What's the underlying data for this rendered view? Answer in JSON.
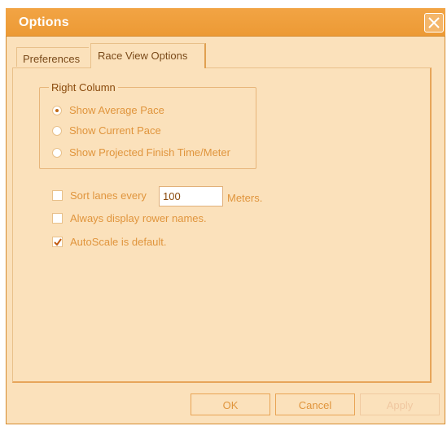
{
  "window": {
    "title": "Options"
  },
  "tabs": [
    {
      "label": "Preferences",
      "selected": false
    },
    {
      "label": "Race View Options",
      "selected": true
    }
  ],
  "right_column": {
    "legend": "Right Column",
    "options": [
      {
        "label": "Show Average Pace",
        "selected": true
      },
      {
        "label": "Show Current Pace",
        "selected": false
      },
      {
        "label": "Show Projected Finish Time/Meter",
        "selected": false
      }
    ]
  },
  "sort_lanes": {
    "label": "Sort lanes every",
    "checked": false,
    "value": "100",
    "unit": "Meters."
  },
  "always_display": {
    "label": "Always display rower names.",
    "checked": false
  },
  "autoscale": {
    "label": "AutoScale is default.",
    "checked": true
  },
  "buttons": {
    "ok": "OK",
    "cancel": "Cancel",
    "apply": "Apply",
    "apply_enabled": false
  },
  "icons": {
    "close": "close-icon",
    "check": "checkmark-icon"
  },
  "colors": {
    "titlebar": "#ec9a35",
    "dialog_bg": "#fbe1bb",
    "text": "#e0953d"
  }
}
